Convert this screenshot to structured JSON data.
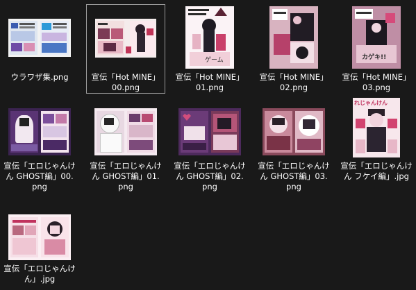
{
  "files": [
    {
      "name": "ウラワザ集.png",
      "selected": false
    },
    {
      "name": "宣伝「Hot MINE」00.png",
      "selected": true
    },
    {
      "name": "宣伝「Hot MINE」01.png",
      "selected": false
    },
    {
      "name": "宣伝「Hot MINE」02.png",
      "selected": false
    },
    {
      "name": "宣伝「Hot MINE」03.png",
      "selected": false
    },
    {
      "name": "宣伝「エロじゃんけん GHOST編」00.png",
      "selected": false
    },
    {
      "name": "宣伝「エロじゃんけん GHOST編」01.png",
      "selected": false
    },
    {
      "name": "宣伝「エロじゃんけん GHOST編」02.png",
      "selected": false
    },
    {
      "name": "宣伝「エロじゃんけん GHOST編」03.png",
      "selected": false
    },
    {
      "name": "宣伝「エロじゃんけん フケイ編」.jpg",
      "selected": false
    },
    {
      "name": "宣伝「エロじゃんけん」.jpg",
      "selected": false
    }
  ],
  "thumb_text": {
    "t2": "ゲーム",
    "t4": "カゲキ!!",
    "t9": "れじゃんけん"
  },
  "colors": {
    "background": "#191919",
    "label": "#ffffff",
    "selection_border": "#9a9a9a"
  }
}
